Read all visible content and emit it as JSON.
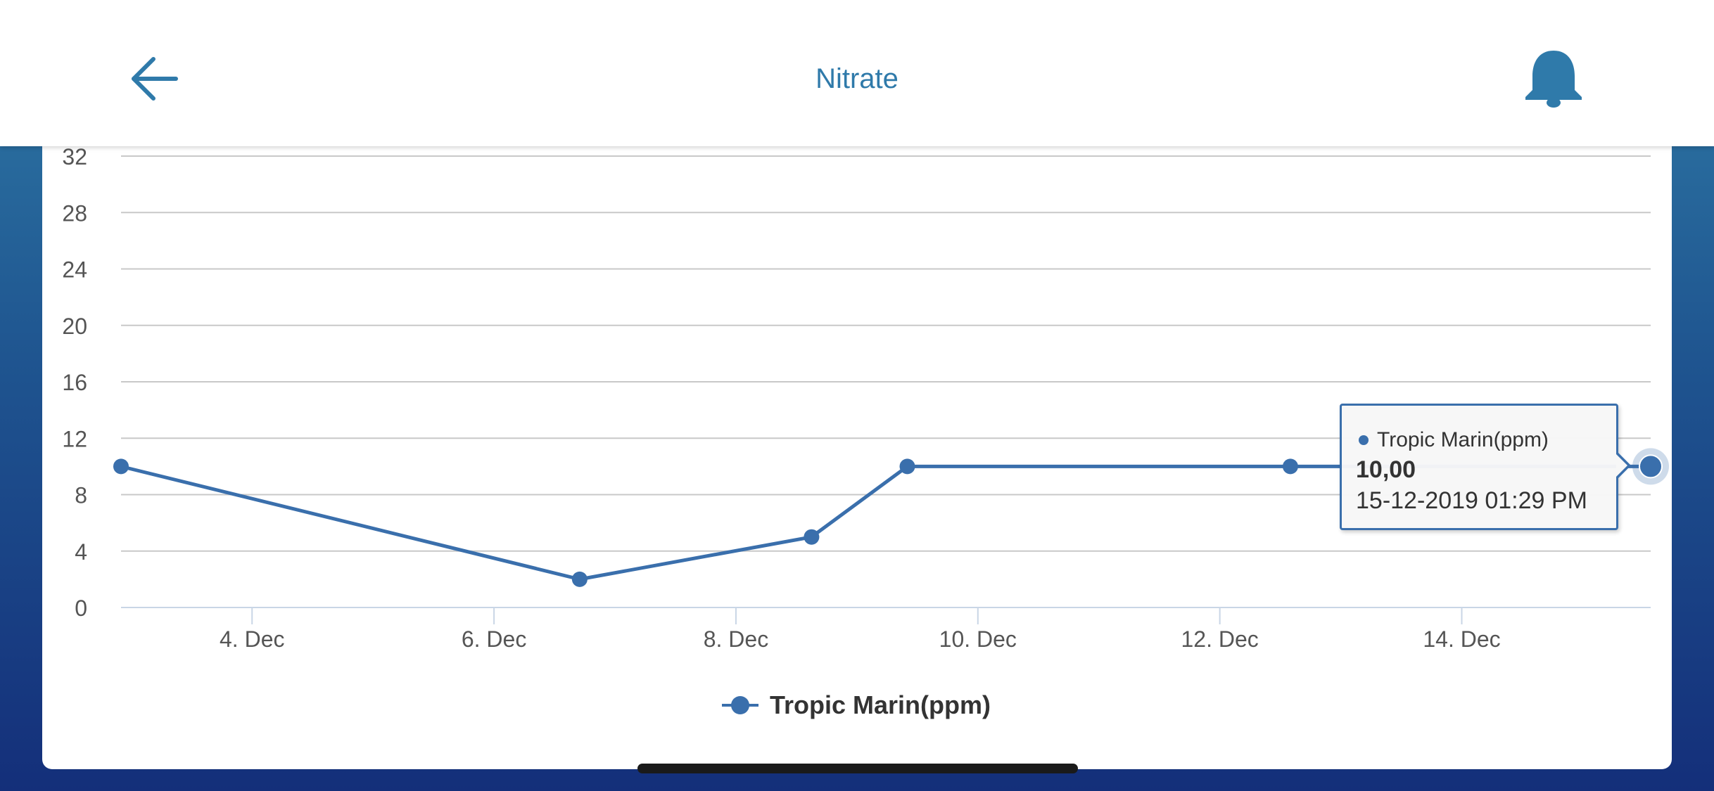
{
  "header": {
    "title": "Nitrate",
    "back_icon": "arrow-left-icon",
    "bell_icon": "bell-icon"
  },
  "colors": {
    "accent": "#2f7aaa",
    "series": "#3a6fac",
    "grid": "#c8c8c8",
    "background_top": "#2f7aa6",
    "background_bottom": "#142f7a"
  },
  "chart_data": {
    "type": "line",
    "title": "",
    "xlabel": "",
    "ylabel": "",
    "ylim": [
      0,
      32
    ],
    "y_ticks": [
      0,
      4,
      8,
      12,
      16,
      20,
      24,
      28,
      32
    ],
    "x_tick_labels": [
      "4. Dec",
      "6. Dec",
      "8. Dec",
      "10. Dec",
      "12. Dec",
      "14. Dec"
    ],
    "x_tick_dates": [
      "2019-12-04",
      "2019-12-06",
      "2019-12-08",
      "2019-12-10",
      "2019-12-12",
      "2019-12-14"
    ],
    "xlim": [
      "2019-12-02T22:00",
      "2019-12-15T13:29"
    ],
    "grid": true,
    "legend_position": "bottom-center",
    "series": [
      {
        "name": "Tropic Marin(ppm)",
        "x": [
          "2019-12-02T22:00",
          "2019-12-06T17:00",
          "2019-12-08T15:00",
          "2019-12-09T10:00",
          "2019-12-12T14:00",
          "2019-12-15T13:29"
        ],
        "values": [
          10,
          2,
          5,
          10,
          10,
          10
        ]
      }
    ]
  },
  "legend": {
    "label": "Tropic Marin(ppm)"
  },
  "tooltip": {
    "series_name": "Tropic Marin(ppm)",
    "value": "10,00",
    "date": "15-12-2019 01:29 PM"
  }
}
